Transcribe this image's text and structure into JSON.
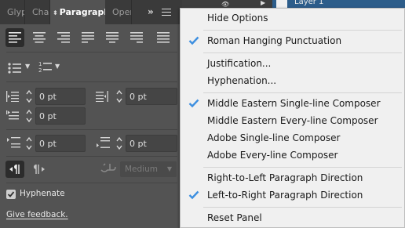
{
  "panel": {
    "tabs": [
      {
        "label": "Glyp"
      },
      {
        "label": "Char"
      },
      {
        "label": "Paragraph"
      },
      {
        "label": "Oper"
      }
    ],
    "active_tab": "Paragraph",
    "indent_left": "0 pt",
    "indent_right": "0 pt",
    "indent_first_line": "0 pt",
    "space_before": "0 pt",
    "space_after": "0 pt",
    "kashida_weight": "Medium",
    "hyphenate_label": "Hyphenate",
    "hyphenate_checked": true,
    "feedback_link": "Give feedback."
  },
  "layers": {
    "layer_name": "Layer 1"
  },
  "menu": {
    "items": [
      {
        "label": "Hide Options",
        "checked": false
      },
      {
        "label": "Roman Hanging Punctuation",
        "checked": true
      },
      {
        "label": "Justification...",
        "checked": false
      },
      {
        "label": "Hyphenation...",
        "checked": false
      },
      {
        "label": "Middle Eastern Single-line Composer",
        "checked": true
      },
      {
        "label": "Middle Eastern Every-line Composer",
        "checked": false
      },
      {
        "label": "Adobe Single-line Composer",
        "checked": false
      },
      {
        "label": "Adobe Every-line Composer",
        "checked": false
      },
      {
        "label": "Right-to-Left Paragraph Direction",
        "checked": false
      },
      {
        "label": "Left-to-Right Paragraph Direction",
        "checked": true
      },
      {
        "label": "Reset Panel",
        "checked": false
      }
    ]
  },
  "colors": {
    "panel_bg": "#535353",
    "menu_bg": "#f0f0f0",
    "check_blue": "#3d8fe0",
    "selection_blue": "#2d5d8a"
  }
}
